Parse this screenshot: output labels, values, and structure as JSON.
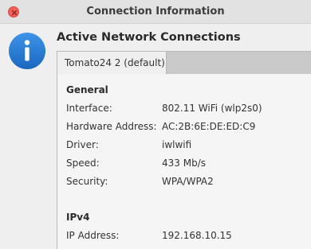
{
  "window": {
    "title": "Connection Information"
  },
  "heading": "Active Network Connections",
  "tabs": [
    {
      "label": "Tomato24 2 (default)"
    }
  ],
  "sections": [
    {
      "title": "General",
      "rows": [
        {
          "label": "Interface:",
          "value": "802.11 WiFi (wlp2s0)"
        },
        {
          "label": "Hardware Address:",
          "value": "AC:2B:6E:DE:ED:C9"
        },
        {
          "label": "Driver:",
          "value": "iwlwifi"
        },
        {
          "label": "Speed:",
          "value": "433 Mb/s"
        },
        {
          "label": "Security:",
          "value": "WPA/WPA2"
        }
      ]
    },
    {
      "title": "IPv4",
      "rows": [
        {
          "label": "IP Address:",
          "value": "192.168.10.15"
        }
      ]
    }
  ],
  "icons": {
    "info": "info-icon",
    "close": "close-icon"
  },
  "colors": {
    "close_button": "#f2625a",
    "info_icon": "#2a7fd5"
  }
}
